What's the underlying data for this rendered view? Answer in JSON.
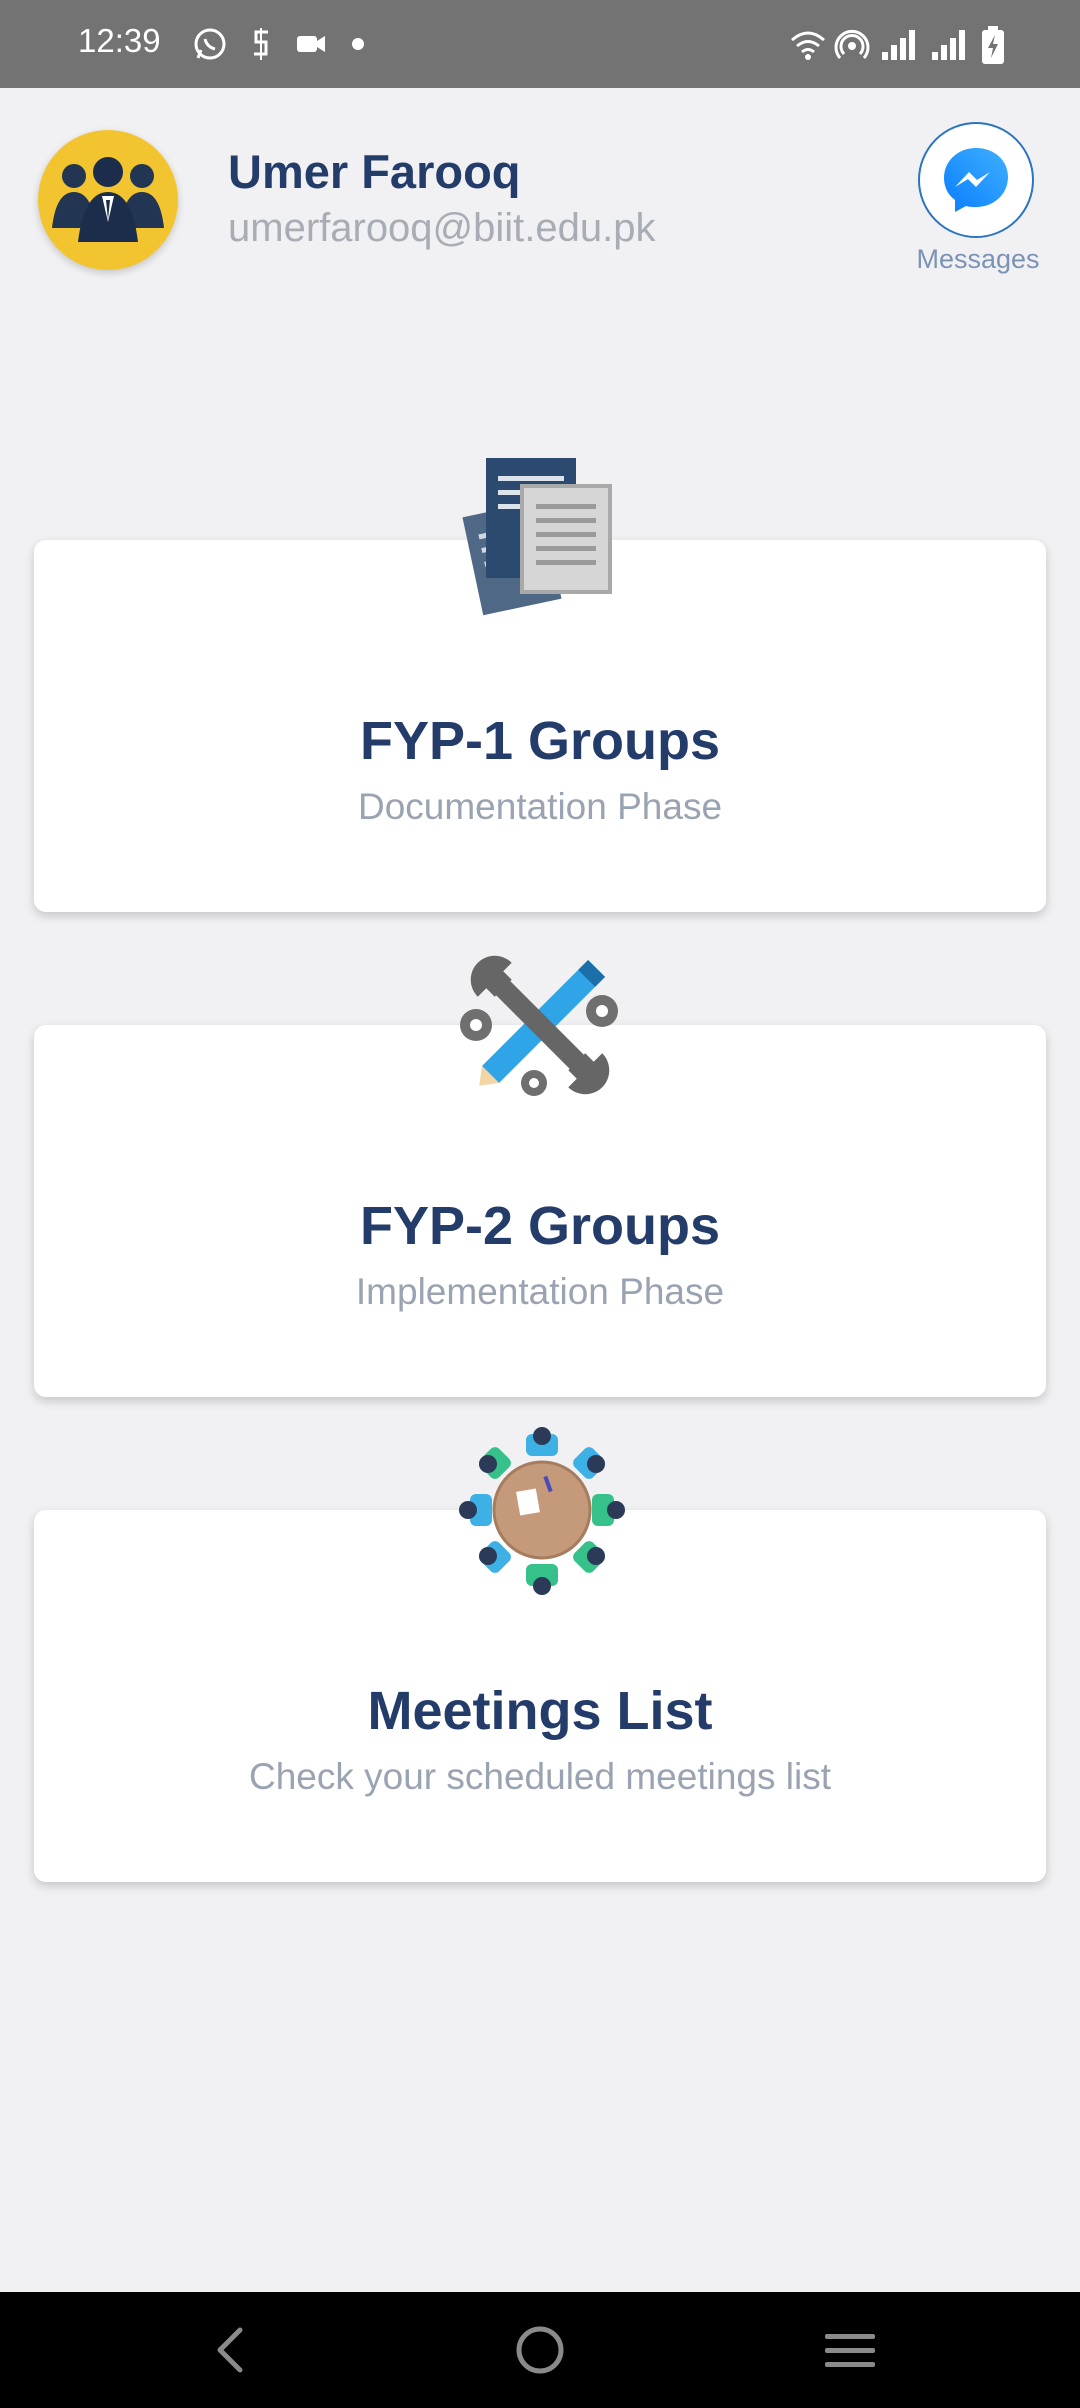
{
  "status_bar": {
    "time": "12:39",
    "left_icons": [
      "whatsapp-icon",
      "app-icon",
      "video-icon",
      "dot-icon"
    ],
    "right_icons": [
      "wifi-icon",
      "hotspot-icon",
      "signal-icon",
      "signal-icon",
      "battery-charging-icon"
    ]
  },
  "profile": {
    "name": "Umer Farooq",
    "email": "umerfarooq@biit.edu.pk",
    "avatar_icon": "group-avatar-icon",
    "avatar_bg": "#f2c530"
  },
  "messages": {
    "label": "Messages",
    "icon": "messenger-icon",
    "accent": "#2a74c2"
  },
  "cards": [
    {
      "title": "FYP-1 Groups",
      "subtitle": "Documentation Phase",
      "icon": "documents-icon"
    },
    {
      "title": "FYP-2 Groups",
      "subtitle": "Implementation Phase",
      "icon": "tools-icon"
    },
    {
      "title": "Meetings List",
      "subtitle": "Check your scheduled meetings list",
      "icon": "meeting-table-icon"
    }
  ],
  "colors": {
    "title": "#233c69",
    "subtitle": "#9aa3b2",
    "background": "#f1f1f3"
  },
  "nav": [
    "back-icon",
    "home-icon",
    "recents-icon"
  ]
}
